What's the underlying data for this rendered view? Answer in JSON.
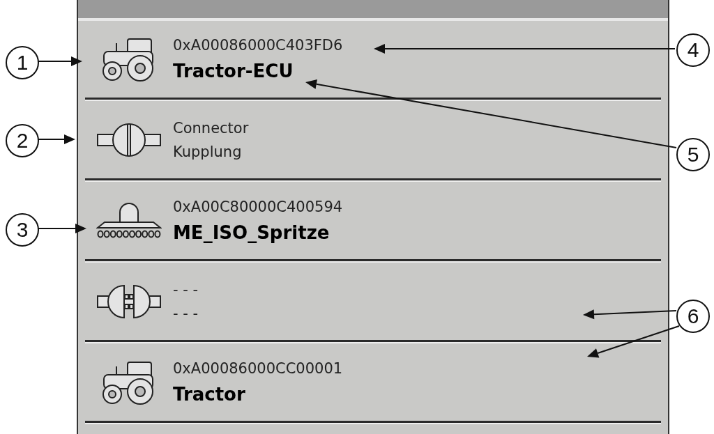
{
  "rows": [
    {
      "kind": "tractor",
      "line1": "0xA00086000C403FD6",
      "line2": "Tractor-ECU"
    },
    {
      "kind": "connector",
      "connected": true,
      "line1": "Connector",
      "line2": "Kupplung"
    },
    {
      "kind": "sprayer",
      "line1": "0xA00C80000C400594",
      "line2": "ME_ISO_Spritze"
    },
    {
      "kind": "connector",
      "connected": false,
      "line1": "- - -",
      "line2": "- - -"
    },
    {
      "kind": "tractor",
      "line1": "0xA00086000CC00001",
      "line2": "Tractor"
    }
  ],
  "callouts": [
    {
      "number": "1"
    },
    {
      "number": "2"
    },
    {
      "number": "3"
    },
    {
      "number": "4"
    },
    {
      "number": "5"
    },
    {
      "number": "6"
    }
  ]
}
